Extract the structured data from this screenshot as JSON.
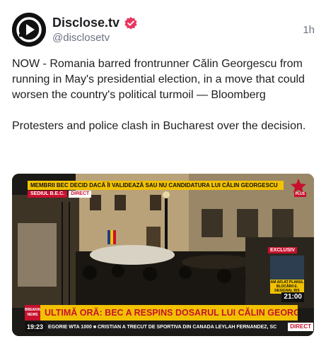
{
  "post": {
    "display_name": "Disclose.tv",
    "handle": "@disclosetv",
    "time": "1h",
    "paragraphs": [
      "NOW - Romania barred frontrunner Călin Georgescu from running in May's presidential election, in a move that could worsen the country's political turmoil — Bloomberg",
      "Protesters and police clash in Bucharest over the decision."
    ]
  },
  "media": {
    "top_banner": "MEMBRII BEC DECID DACĂ ÎI VALIDEAZĂ SAU NU CANDIDATURA LUI CĂLIN GEORGESCU",
    "location_label": "SEDIUL B.E.C.",
    "direct_label": "DIRECT",
    "channel_plus": "PLUS",
    "exclusive_label": "EXCLUSIV",
    "inset_caption": "AM AFLAT PLANUL BLOCĂRII E. DESIGNAL BIS",
    "clock": "21:00",
    "breaking_label": "BREAKING NEWS",
    "headline": "ULTIMĂ ORĂ: BEC A RESPINS DOSARUL LUI CĂLIN GEORGESCU",
    "ticker_time": "19:23",
    "ticker_text": "EGORIE WTA 1000  ■  CRISTIAN A TRECUT DE SPORTIVA DIN CANADA LEYLAH FERNANDEZ, SC",
    "ticker_direct": "DIRECT"
  },
  "colors": {
    "accent_verified": "#e8365d",
    "banner_yellow": "#f2c200",
    "news_red": "#c8102e",
    "muted_text": "#6b7280"
  },
  "icons": {
    "avatar": "disclose-logo-icon",
    "verified": "verified-badge-icon"
  }
}
